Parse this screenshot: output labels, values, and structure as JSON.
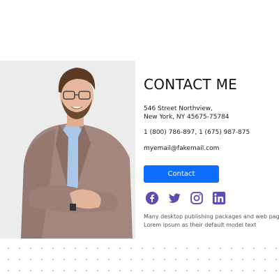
{
  "contact": {
    "title": "CONTACT ME",
    "address_line1": "546 Street Northview,",
    "address_line2": "New York, NY 45675-75784",
    "phone": "1 (800) 786-897, 1 (675) 987-875",
    "email": "myemail@fakemail.com",
    "button_label": "Contact",
    "blurb_line1": "Many desktop publishing packages and web page",
    "blurb_line2": "Lorem Ipsum as their default model text"
  },
  "social": {
    "icons": [
      "facebook-icon",
      "twitter-icon",
      "instagram-icon",
      "linkedin-icon"
    ],
    "color": "#5a4fb0"
  },
  "colors": {
    "accent": "#0d6efd",
    "icon": "#5a4fb0",
    "photo_bg": "#ececec"
  }
}
